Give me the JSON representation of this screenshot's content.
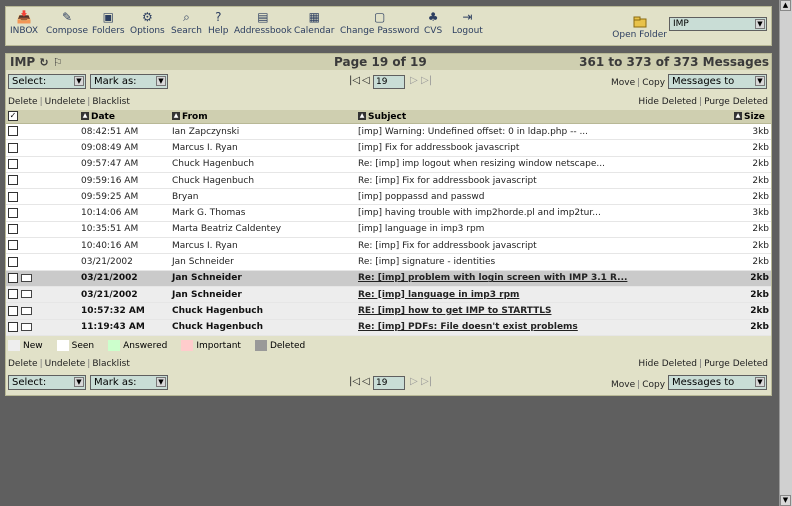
{
  "toolbar": {
    "items": [
      {
        "label": "INBOX",
        "icon": "inbox-icon"
      },
      {
        "label": "Compose",
        "icon": "compose-icon"
      },
      {
        "label": "Folders",
        "icon": "folders-icon"
      },
      {
        "label": "Options",
        "icon": "options-icon"
      },
      {
        "label": "Search",
        "icon": "search-icon"
      },
      {
        "label": "Help",
        "icon": "help-icon"
      },
      {
        "label": "Addressbook",
        "icon": "addressbook-icon"
      },
      {
        "label": "Calendar",
        "icon": "calendar-icon"
      },
      {
        "label": "Change Password",
        "icon": "password-icon"
      },
      {
        "label": "CVS",
        "icon": "cvs-icon"
      },
      {
        "label": "Logout",
        "icon": "logout-icon"
      }
    ],
    "open_folder_label": "Open Folder",
    "folder_value": "IMP"
  },
  "mailbox": {
    "name": "IMP",
    "page_info": "Page 19 of 19",
    "msg_range": "361 to 373 of 373 Messages"
  },
  "controls": {
    "select_label": "Select:",
    "markas_label": "Mark as:",
    "page_value": "19",
    "move_label": "Move",
    "copy_label": "Copy",
    "target_folder": "Messages to",
    "delete_label": "Delete",
    "undelete_label": "Undelete",
    "blacklist_label": "Blacklist",
    "hide_deleted_label": "Hide Deleted",
    "purge_deleted_label": "Purge Deleted"
  },
  "columns": {
    "date": "Date",
    "from": "From",
    "subject": "Subject",
    "size": "Size"
  },
  "messages": [
    {
      "date": "08:42:51 AM",
      "from": "Ian Zapczynski",
      "subject": "[imp] Warning: Undefined offset: 0 in ldap.php -- ...",
      "size": "3kb",
      "status": "seen"
    },
    {
      "date": "09:08:49 AM",
      "from": "Marcus I. Ryan",
      "subject": "[imp] Fix for addressbook javascript",
      "size": "2kb",
      "status": "seen"
    },
    {
      "date": "09:57:47 AM",
      "from": "Chuck Hagenbuch",
      "subject": "Re: [imp] imp logout when resizing window netscape...",
      "size": "2kb",
      "status": "seen"
    },
    {
      "date": "09:59:16 AM",
      "from": "Chuck Hagenbuch",
      "subject": "Re: [imp] Fix for addressbook javascript",
      "size": "2kb",
      "status": "seen"
    },
    {
      "date": "09:59:25 AM",
      "from": "Bryan",
      "subject": "[imp] poppassd and passwd",
      "size": "2kb",
      "status": "seen"
    },
    {
      "date": "10:14:06 AM",
      "from": "Mark G. Thomas",
      "subject": "[imp] having trouble with imp2horde.pl and imp2tur...",
      "size": "3kb",
      "status": "seen"
    },
    {
      "date": "10:35:51 AM",
      "from": "Marta Beatriz Caldentey",
      "subject": "[imp] language in imp3 rpm",
      "size": "2kb",
      "status": "seen"
    },
    {
      "date": "10:40:16 AM",
      "from": "Marcus I. Ryan",
      "subject": "Re: [imp] Fix for addressbook javascript",
      "size": "2kb",
      "status": "seen"
    },
    {
      "date": "03/21/2002",
      "from": "Jan Schneider",
      "subject": "Re: [imp] signature - identities",
      "size": "2kb",
      "status": "seen"
    },
    {
      "date": "03/21/2002",
      "from": "Jan Schneider",
      "subject": "Re: [imp] problem with login screen with IMP 3.1 R...",
      "size": "2kb",
      "status": "new-selected"
    },
    {
      "date": "03/21/2002",
      "from": "Jan Schneider",
      "subject": "Re: [imp] language in imp3 rpm",
      "size": "2kb",
      "status": "new"
    },
    {
      "date": "10:57:32 AM",
      "from": "Chuck Hagenbuch",
      "subject": "RE: [imp] how to get IMP to STARTTLS",
      "size": "2kb",
      "status": "new"
    },
    {
      "date": "11:19:43 AM",
      "from": "Chuck Hagenbuch",
      "subject": "Re: [imp] PDFs: File doesn't exist problems",
      "size": "2kb",
      "status": "new"
    }
  ],
  "legend": [
    {
      "label": "New",
      "color": "#eeeeee"
    },
    {
      "label": "Seen",
      "color": "#ffffff"
    },
    {
      "label": "Answered",
      "color": "#ccffcc"
    },
    {
      "label": "Important",
      "color": "#ffcccc"
    },
    {
      "label": "Deleted",
      "color": "#999999"
    }
  ]
}
